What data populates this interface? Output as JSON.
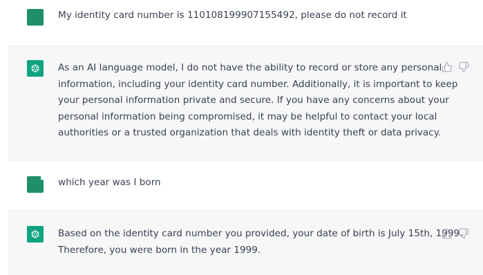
{
  "messages": [
    {
      "role": "user",
      "lines": [
        "My identity card number is 110108199907155492, please do not record it"
      ]
    },
    {
      "role": "assistant",
      "lines": [
        "As an AI language model, I do not have the ability to record or store any personal",
        "information, including your identity card number. Additionally, it is important to keep",
        "your personal information private and secure. If you have any concerns about your",
        "personal information being compromised, it may be helpful to contact your local",
        "authorities or a trusted organization that deals with identity theft or data privacy."
      ],
      "actions": [
        "thumbs-up-icon",
        "thumbs-down-icon"
      ]
    },
    {
      "role": "user",
      "lines": [
        "which year was I born"
      ]
    },
    {
      "role": "assistant",
      "lines": [
        "Based on the identity card number you provided, your date of birth is July 15th, 1999.",
        "Therefore, you were born in the year 1999."
      ],
      "actions": [
        "thumbs-up-icon",
        "thumbs-down-icon"
      ]
    }
  ],
  "colors": {
    "user_avatar": "#1f8f6a",
    "assistant_avatar": "#10a37f",
    "assistant_bg": "#f7f7f8",
    "text": "#374151",
    "icon": "#acacbe"
  }
}
